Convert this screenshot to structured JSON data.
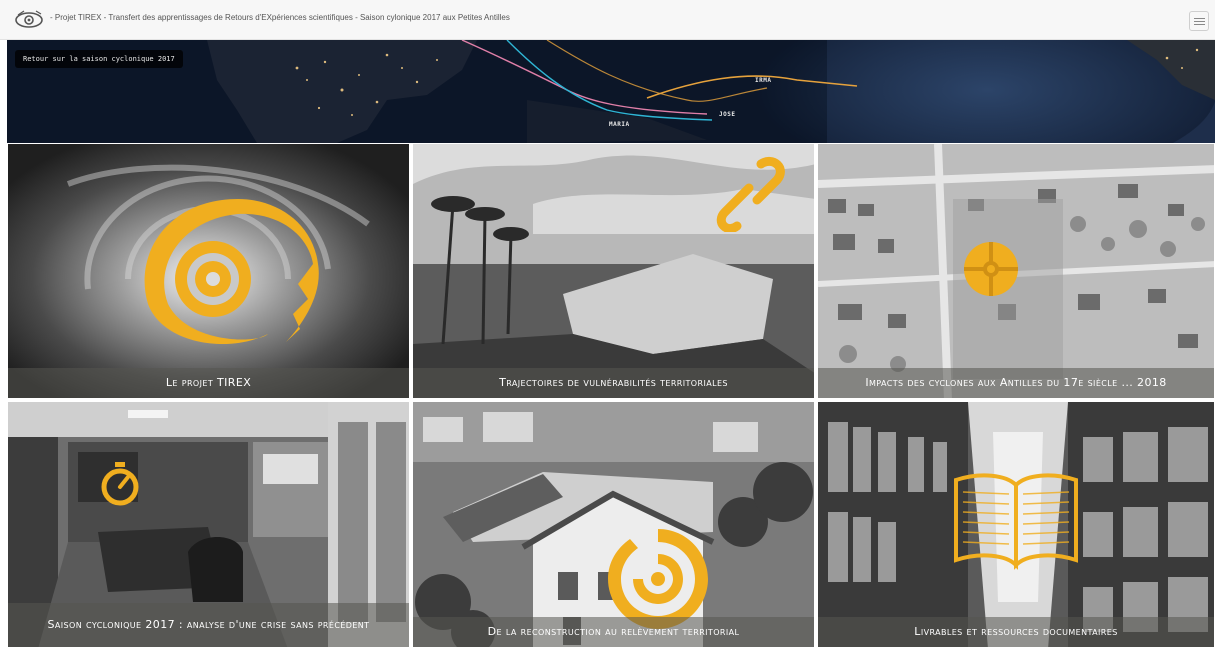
{
  "header": {
    "title": "- Projet TIREX - Transfert des apprentissages de Retours d'EXpériences scientifiques - Saison cylonique 2017 aux Petites Antilles",
    "logo_icon": "tirex-eye-icon",
    "menu_icon": "hamburger-icon"
  },
  "banner": {
    "back_button_label": "Retour sur la saison cyclonique 2017",
    "storms": [
      "IRMA",
      "JOSE",
      "MARIA"
    ],
    "storm_colors": {
      "IRMA": "#e6a23c",
      "JOSE": "#2fb5d4",
      "MARIA": "#e07fa8"
    }
  },
  "tiles": [
    {
      "caption": "Le projet TIREX",
      "icon": "tirex-eye-logo-icon"
    },
    {
      "caption": "Trajectoires de vulnérabilités territoriales",
      "icon": "chain-link-icon"
    },
    {
      "caption": "Impacts des cyclones aux Antilles du 17e siècle ... 2018",
      "icon": "wheel-cross-icon"
    },
    {
      "caption": "Saison cyclonique 2017 : analyse d'une crise sans précédent",
      "icon": "stopwatch-icon"
    },
    {
      "caption": "De la reconstruction au relèvement territorial",
      "icon": "spiral-target-icon"
    },
    {
      "caption": "Livrables et ressources documentaires",
      "icon": "open-book-icon"
    }
  ],
  "colors": {
    "accent": "#f0ae1f",
    "navbar": "#f7f7f7"
  }
}
